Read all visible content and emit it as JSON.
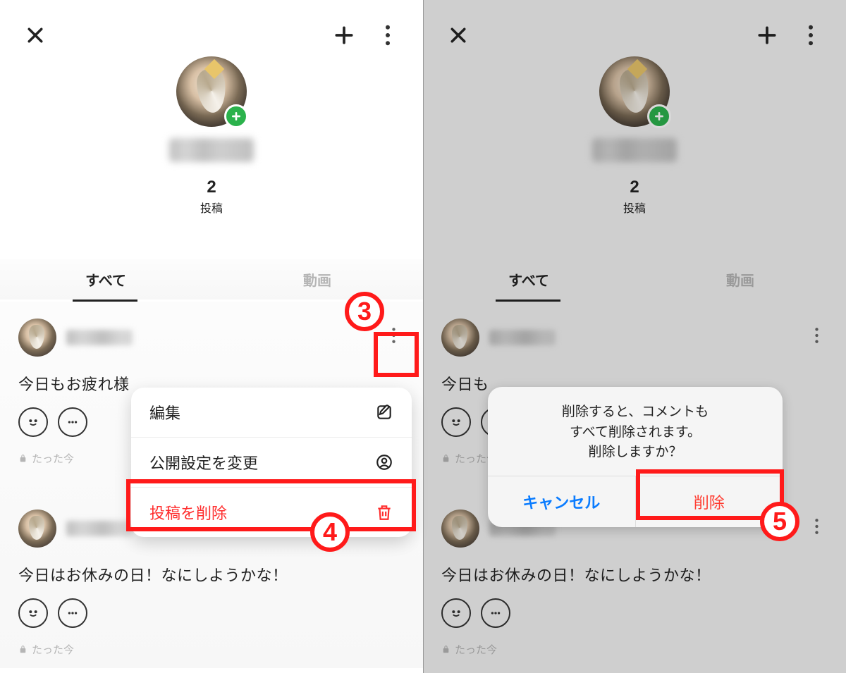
{
  "header": {
    "post_count_num": "2",
    "post_count_label": "投稿"
  },
  "tabs": {
    "all": "すべて",
    "video": "動画"
  },
  "posts": [
    {
      "text": "今日もお疲れ様",
      "time_label": "たった今"
    },
    {
      "text": "今日はお休みの日！なにしようかな！",
      "time_label": "たった今"
    }
  ],
  "menu": {
    "edit": "編集",
    "privacy": "公開設定を変更",
    "delete": "投稿を削除"
  },
  "alert": {
    "line1": "削除すると、コメントも",
    "line2": "すべて削除されます。",
    "line3": "削除しますか？",
    "cancel": "キャンセル",
    "delete": "削除"
  },
  "left_post_text_truncated": "今日もお疲れ様",
  "right_post_text_truncated": "今日も",
  "annotations": {
    "step3": "3",
    "step4": "4",
    "step5": "5"
  }
}
